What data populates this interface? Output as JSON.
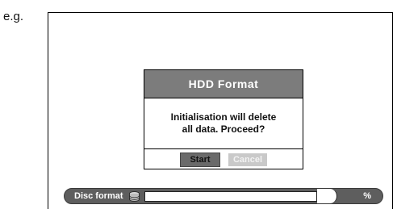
{
  "caption": "e.g.",
  "dialog": {
    "title": "HDD Format",
    "message_line1": "Initialisation will delete",
    "message_line2": "all data. Proceed?",
    "start_label": "Start",
    "cancel_label": "Cancel",
    "selected_button": "Start"
  },
  "progress": {
    "label": "Disc format",
    "icon": "disc-icon",
    "percent_symbol": "%",
    "value_fraction": 0.0
  },
  "colors": {
    "title_bar": "#7c7c7c",
    "start_button": "#6a6a6a",
    "cancel_button": "#c9c9c9",
    "progress_bar_bg": "#5e5e5e"
  }
}
